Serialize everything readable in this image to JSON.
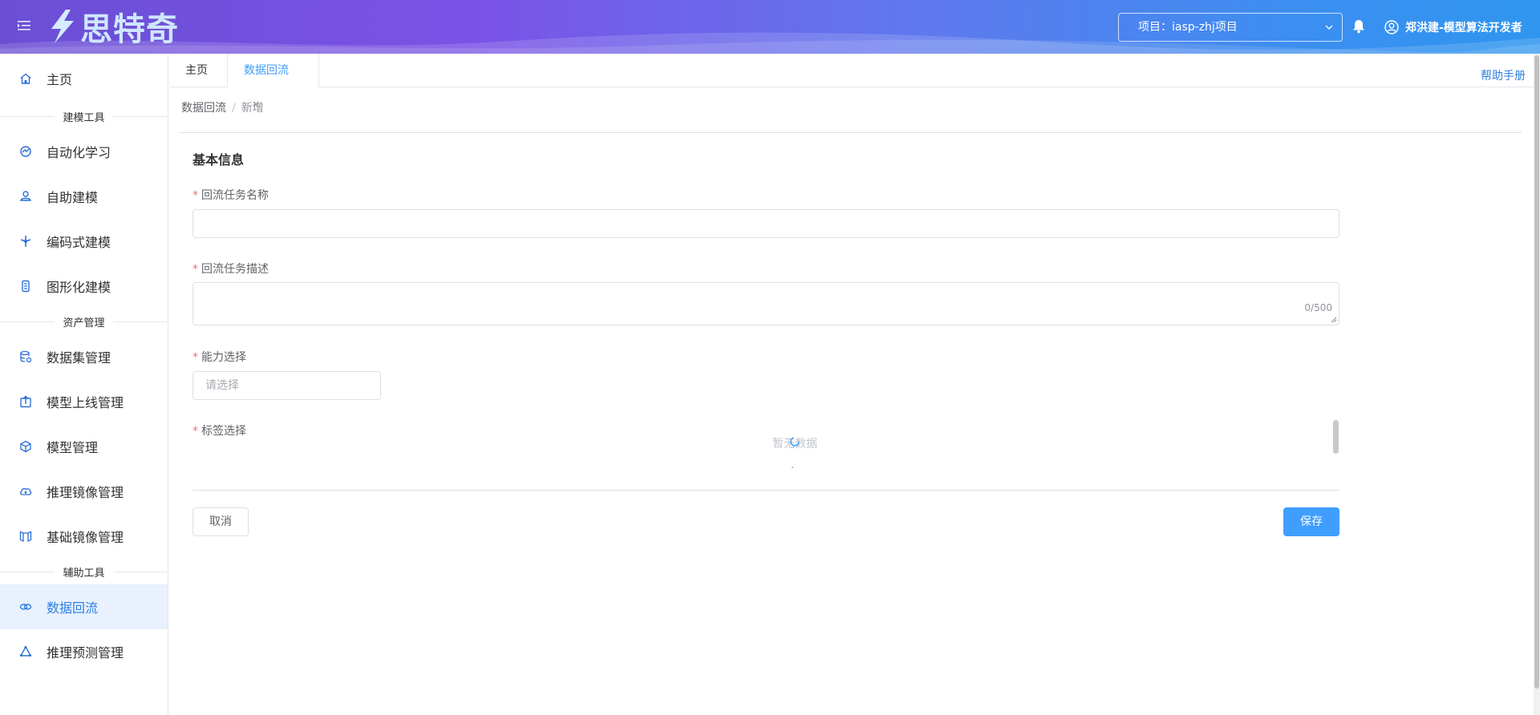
{
  "header": {
    "brand": "思特奇",
    "project_label": "项目：iasp-zhj项目",
    "user_name": "郑洪建-模型算法开发者",
    "icons": [
      "menu-toggle-icon",
      "logo-bolt-icon",
      "chevron-down-icon",
      "bell-icon",
      "user-circle-icon"
    ]
  },
  "sidebar": {
    "home": {
      "label": "主页",
      "icon": "home-icon"
    },
    "groups": [
      {
        "title": "建模工具",
        "items": [
          {
            "label": "自动化学习",
            "icon": "automl-icon"
          },
          {
            "label": "自助建模",
            "icon": "self-modeling-icon"
          },
          {
            "label": "编码式建模",
            "icon": "code-modeling-icon"
          },
          {
            "label": "图形化建模",
            "icon": "graphic-modeling-icon"
          }
        ]
      },
      {
        "title": "资产管理",
        "items": [
          {
            "label": "数据集管理",
            "icon": "dataset-icon"
          },
          {
            "label": "模型上线管理",
            "icon": "model-deploy-icon"
          },
          {
            "label": "模型管理",
            "icon": "model-cube-icon"
          },
          {
            "label": "推理镜像管理",
            "icon": "inference-image-icon"
          },
          {
            "label": "基础镜像管理",
            "icon": "base-image-icon"
          }
        ]
      },
      {
        "title": "辅助工具",
        "items": [
          {
            "label": "数据回流",
            "icon": "data-reflow-icon",
            "active": true
          },
          {
            "label": "推理预测管理",
            "icon": "inference-predict-icon"
          }
        ]
      }
    ]
  },
  "tabs": [
    {
      "label": "主页"
    },
    {
      "label": "数据回流",
      "active": true,
      "closable": true,
      "close_symbol": "×"
    }
  ],
  "help_link": "帮助手册",
  "breadcrumb": {
    "parent": "数据回流",
    "separator": "/",
    "current": "新增"
  },
  "form": {
    "section_title": "基本信息",
    "required_mark": "*",
    "name_label": "回流任务名称",
    "name_value": "",
    "desc_label": "回流任务描述",
    "desc_value": "",
    "desc_counter": "0/500",
    "ability_label": "能力选择",
    "ability_placeholder": "请选择",
    "tag_label": "标签选择",
    "tag_empty_text": "暂无数据"
  },
  "buttons": {
    "cancel": "取消",
    "save": "保存"
  },
  "colors": {
    "primary": "#409eff",
    "required": "#f56c6c",
    "active_bg": "#e8f1fd",
    "header_start": "#6a4fd4",
    "header_end": "#2f96ef"
  }
}
